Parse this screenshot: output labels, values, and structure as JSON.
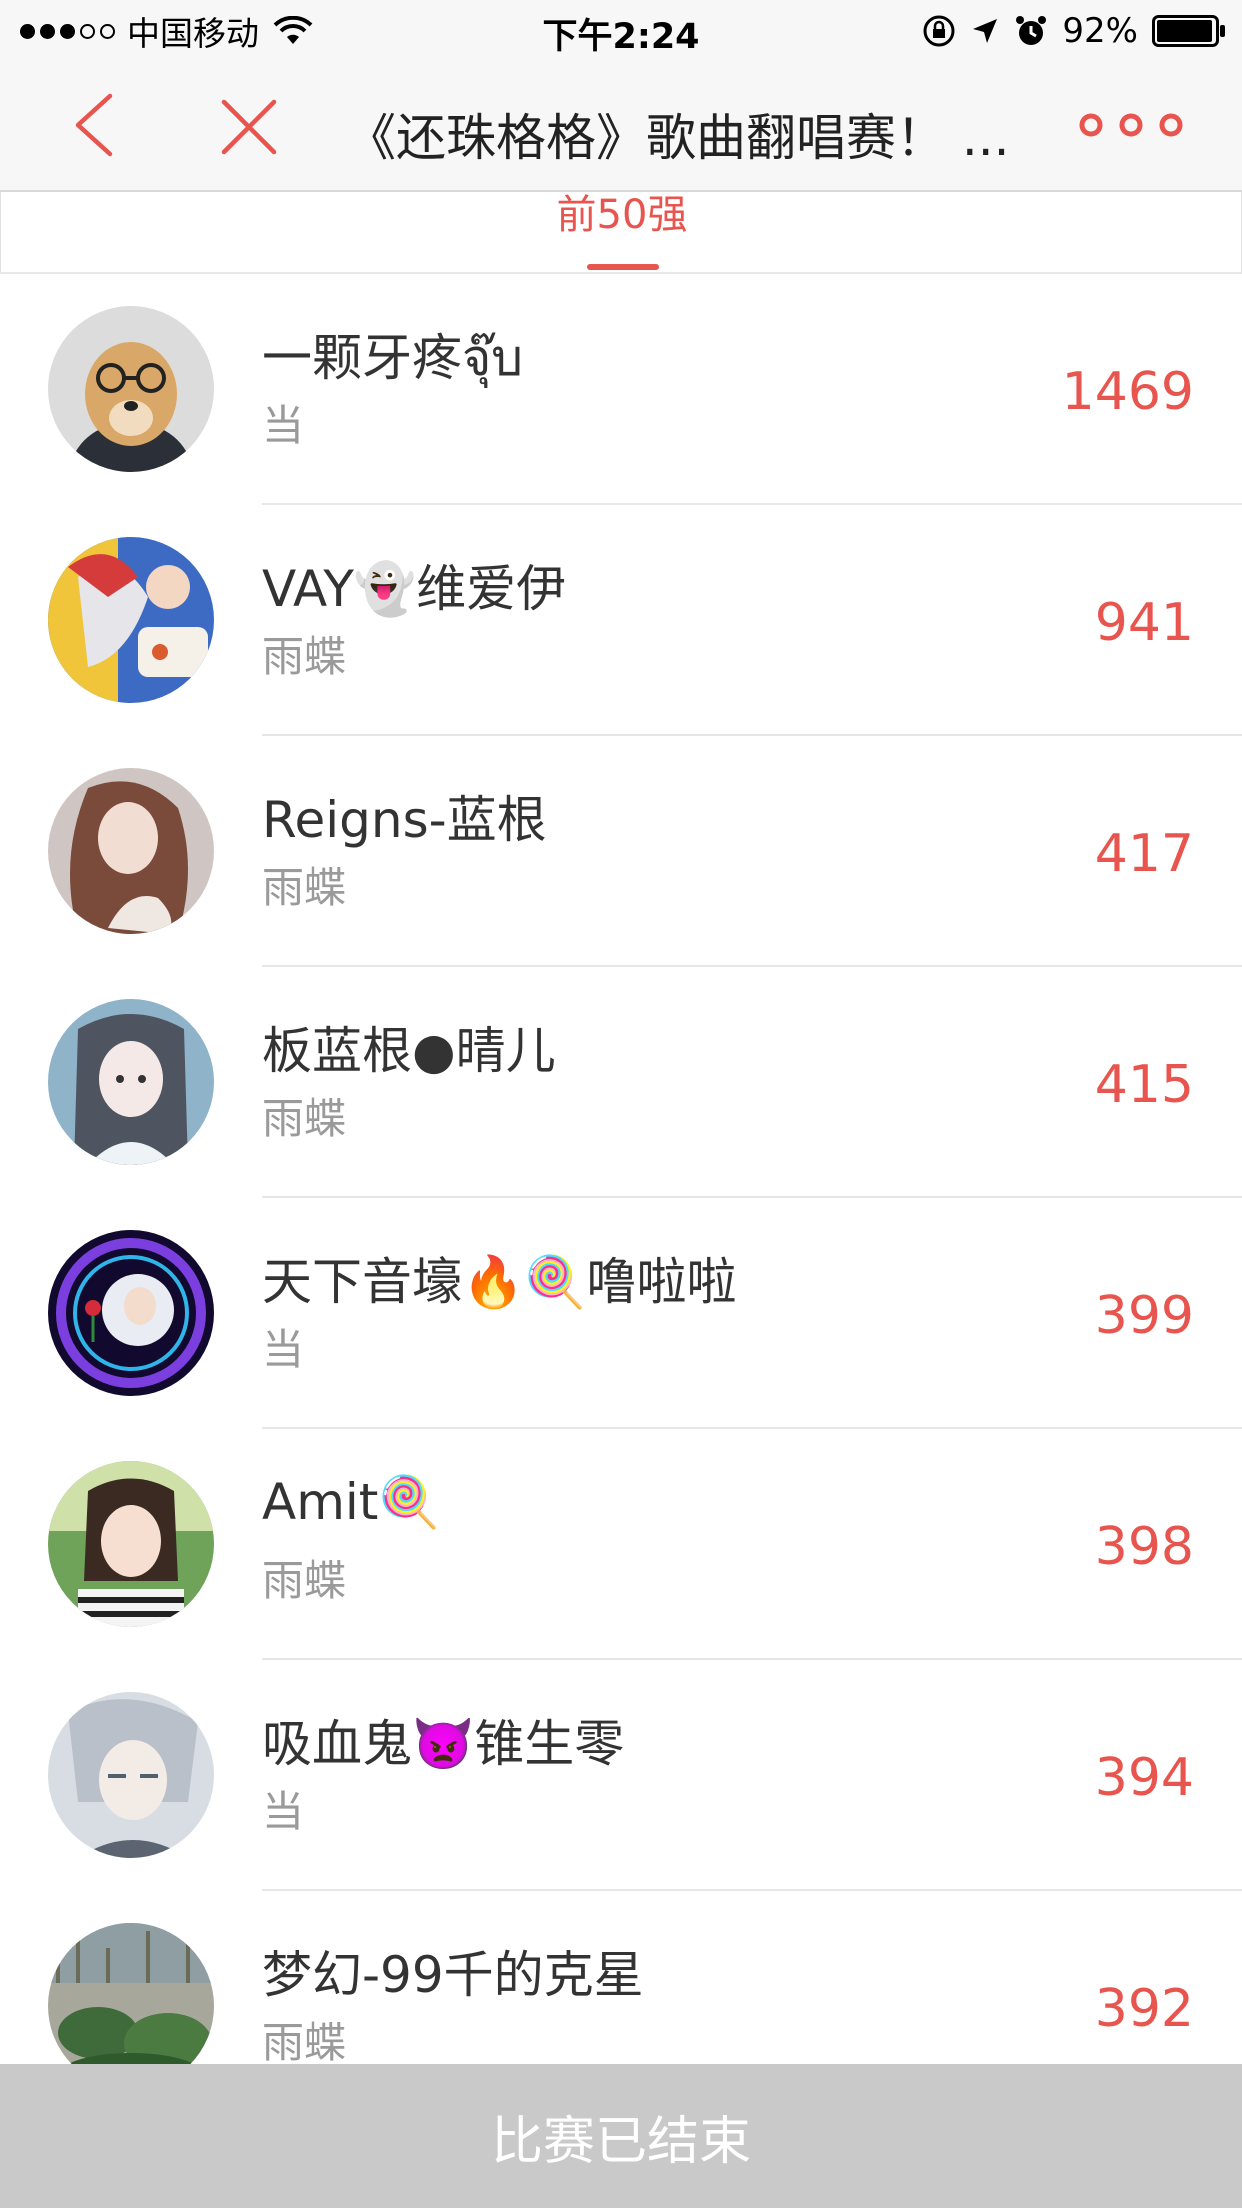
{
  "status_bar": {
    "carrier": "中国移动",
    "time": "下午2:24",
    "battery": "92%",
    "signal_bars_on": 3,
    "signal_bars_total": 5
  },
  "nav": {
    "title": "《还珠格格》歌曲翻唱赛！ ...",
    "back_icon": "chevron-left-icon",
    "close_icon": "close-icon",
    "more_icon": "more-icon"
  },
  "tab": {
    "label": "前50强"
  },
  "colors": {
    "accent": "#e8544e",
    "bar_bg": "#f7f7f7",
    "bottom_bar": "#c9c9c9"
  },
  "ranking": [
    {
      "name": "一颗牙疼จุ๊บ",
      "sub": "当",
      "votes": "1469"
    },
    {
      "name": "VAY👻维爱伊",
      "sub": "雨蝶",
      "votes": "941"
    },
    {
      "name": "Reigns-蓝根",
      "sub": "雨蝶",
      "votes": "417"
    },
    {
      "name": "板蓝根●晴儿",
      "sub": "雨蝶",
      "votes": "415"
    },
    {
      "name": "天下音壕🔥🍭噜啦啦",
      "sub": "当",
      "votes": "399"
    },
    {
      "name": "Amit🍭",
      "sub": "雨蝶",
      "votes": "398"
    },
    {
      "name": "吸血鬼👿锥生零",
      "sub": "当",
      "votes": "394"
    },
    {
      "name": "梦幻-99千的克星",
      "sub": "雨蝶",
      "votes": "392"
    }
  ],
  "footer": {
    "label": "比赛已结束"
  }
}
